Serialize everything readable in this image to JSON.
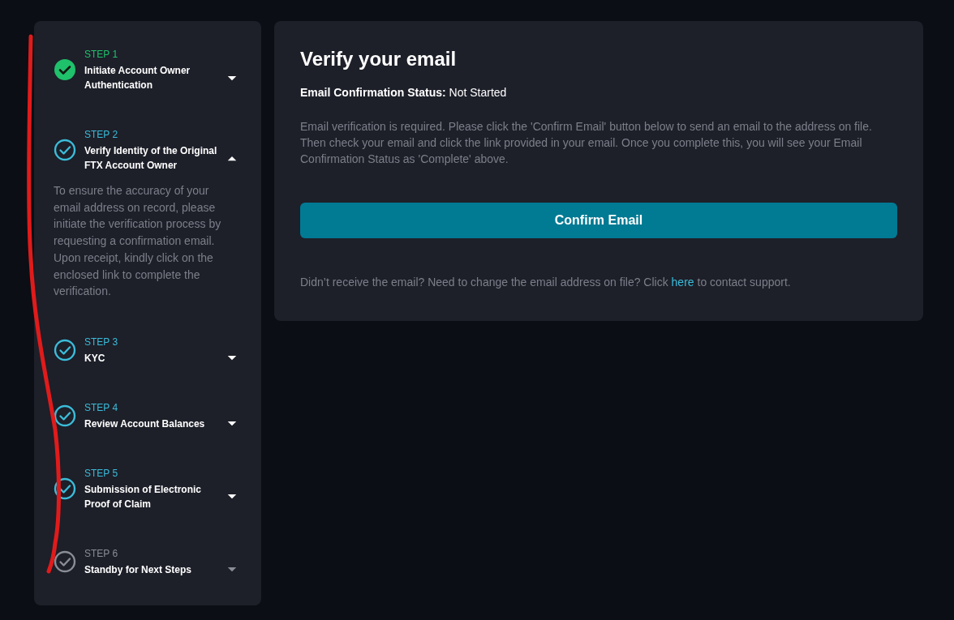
{
  "steps": [
    {
      "label": "STEP 1",
      "title": "Initiate Account Owner Authentication",
      "kind": "complete",
      "expanded": false
    },
    {
      "label": "STEP 2",
      "title": "Verify Identity of the Original FTX Account Owner",
      "kind": "active",
      "expanded": true,
      "description": "To ensure the accuracy of your email address on record, please initiate the verification process by requesting a confirmation email. Upon receipt, kindly click on the enclosed link to complete the verification."
    },
    {
      "label": "STEP 3",
      "title": "KYC",
      "kind": "active",
      "expanded": false
    },
    {
      "label": "STEP 4",
      "title": "Review Account Balances",
      "kind": "active",
      "expanded": false
    },
    {
      "label": "STEP 5",
      "title": "Submission of Electronic Proof of Claim",
      "kind": "active",
      "expanded": false
    },
    {
      "label": "STEP 6",
      "title": "Standby for Next Steps",
      "kind": "pending",
      "expanded": false
    }
  ],
  "panel": {
    "title": "Verify your email",
    "status_line": "**Email Confirmation Status:** Not Started",
    "instructions": "Email verification is required. Please click the 'Confirm Email' button below to send an email to the address on file. Then check your email and click the link provided in your email. Once you complete this, you will see your Email Confirmation Status as 'Complete' above.",
    "button": "Confirm Email",
    "support": {
      "before": "Didn’t receive the email? Need to change the email address on file? Click ",
      "link": "here",
      "after": " to contact support."
    }
  }
}
